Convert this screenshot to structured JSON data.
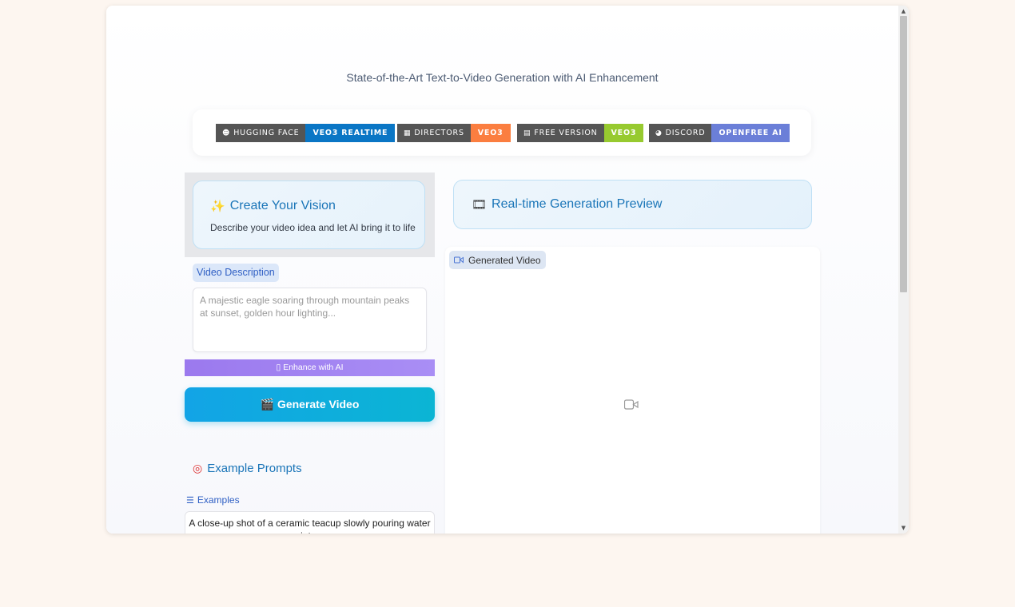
{
  "header": {
    "subtitle": "State-of-the-Art Text-to-Video Generation with AI Enhancement"
  },
  "badges": [
    {
      "left": "HUGGING FACE",
      "right": "VEO3 REALTIME",
      "icon": "hugging-face-icon",
      "color": "#0a76c5"
    },
    {
      "left": "DIRECTORS",
      "right": "VEO3",
      "icon": "clapper-icon",
      "color": "#fb7e40"
    },
    {
      "left": "FREE VERSION",
      "right": "VEO3",
      "icon": "film-icon",
      "color": "#97ca2f"
    },
    {
      "left": "DISCORD",
      "right": "OPENFREE AI",
      "icon": "discord-icon",
      "color": "#6b7fd8"
    }
  ],
  "left": {
    "vision_title": "Create Your Vision",
    "vision_desc": "Describe your video idea and let AI bring it to life",
    "input_label": "Video Description",
    "input_placeholder": "A majestic eagle soaring through mountain peaks at sunset, golden hour lighting...",
    "enhance_label": "▯ Enhance with AI",
    "generate_label": "Generate Video",
    "examples_title": "Example Prompts",
    "examples_label": "Examples",
    "example_first": "A close-up shot of a ceramic teacup slowly pouring water int..."
  },
  "right": {
    "preview_title": "Real-time Generation Preview",
    "video_label": "Generated Video"
  }
}
